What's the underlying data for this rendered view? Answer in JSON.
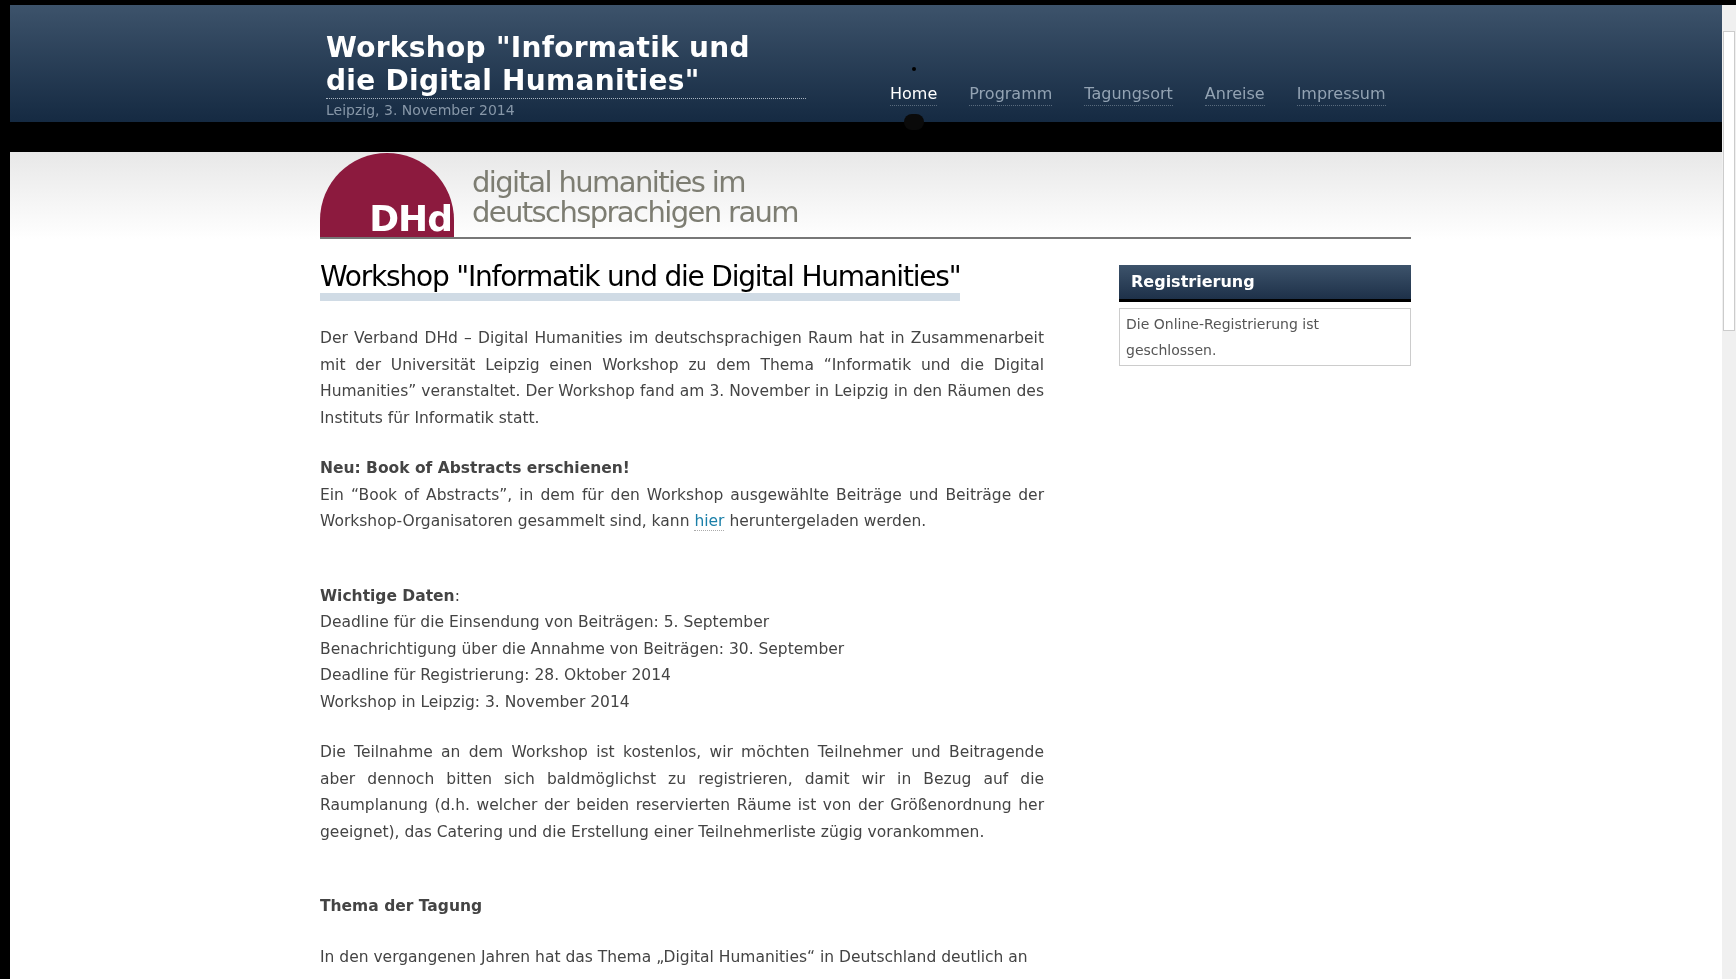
{
  "site": {
    "title_lines": [
      "Workshop \"Informatik und",
      "die Digital Humanities\""
    ],
    "subtitle": "Leipzig, 3. November 2014"
  },
  "nav": [
    {
      "label": "Home",
      "selected": true
    },
    {
      "label": "Programm",
      "selected": false
    },
    {
      "label": "Tagungsort",
      "selected": false
    },
    {
      "label": "Anreise",
      "selected": false
    },
    {
      "label": "Impressum",
      "selected": false
    }
  ],
  "logo": {
    "mark": "DHd",
    "lines": [
      "digital humanities im",
      "deutschsprachigen raum"
    ]
  },
  "article": {
    "heading": "Workshop \"Informatik und die Digital Humanities\"",
    "blocks": [
      {
        "kind": "paragraph",
        "text": "Der Verband DHd – Digital Humanities im deutschsprachigen Raum hat in Zusammenarbeit mit der Universität Leipzig einen Workshop zu dem Thema “Informatik und die Digital Humanities” veranstaltet. Der Workshop fand am 3. November in Leipzig in den Räumen des Instituts für Informatik statt."
      },
      {
        "kind": "subheading",
        "text": "Neu: Book of Abstracts erschienen!"
      },
      {
        "kind": "link_paragraph",
        "before": "Ein “Book of Abstracts”, in dem für den Workshop ausgewählte Beiträge und Beiträge der Workshop-Organisatoren gesammelt sind, kann",
        "link": "hier",
        "after": "heruntergeladen werden."
      },
      {
        "kind": "gap"
      },
      {
        "kind": "list",
        "title": "**Wichtige Daten**:",
        "lines": [
          "Deadline für die Einsendung von Beiträgen: 5. September",
          "Benachrichtigung über die Annahme von Beiträgen: 30. September",
          "Deadline für Registrierung: 28. Oktober 2014",
          "Workshop in Leipzig: 3. November 2014"
        ]
      },
      {
        "kind": "paragraph",
        "text": "Die Teilnahme an dem Workshop ist kostenlos, wir möchten Teilnehmer und Beitragende aber dennoch bitten sich baldmöglichst zu registrieren, damit wir in Bezug auf die Raumplanung (d.h. welcher der beiden reservierten Räume ist von der Größenordnung her geeignet), das Catering und die Erstellung einer Teilnehmerliste zügig vorankommen."
      },
      {
        "kind": "gap"
      },
      {
        "kind": "subheading",
        "text": "Thema der Tagung"
      },
      {
        "kind": "paragraph",
        "text": "In den vergangenen Jahren hat das Thema „Digital Humanities“ in Deutschland deutlich an"
      }
    ]
  },
  "sidebar": {
    "widget_title": "Registrierung",
    "widget_text": "Die Online-Registrierung ist geschlossen."
  }
}
